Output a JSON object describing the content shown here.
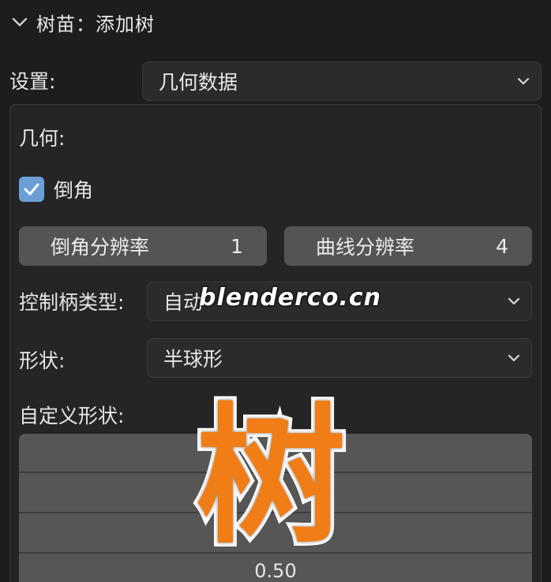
{
  "header": {
    "title": "树苗：添加树",
    "chevron_icon": "chevron-down-icon"
  },
  "settings": {
    "label": "设置:",
    "selected": "几何数据"
  },
  "geometry": {
    "section_title": "几何:",
    "bevel_checkbox": {
      "label": "倒角",
      "checked": true
    },
    "bevel_resolution": {
      "label": "倒角分辨率",
      "value": "1"
    },
    "curve_resolution": {
      "label": "曲线分辨率",
      "value": "4"
    },
    "handle_type": {
      "label": "控制柄类型:",
      "selected": "自动"
    },
    "shape": {
      "label": "形状:",
      "selected": "半球形"
    },
    "custom_shape": {
      "label": "自定义形状:",
      "visible_tick": "0.50"
    }
  },
  "watermark": {
    "site": "blenderco.cn",
    "char": "树"
  },
  "colors": {
    "background": "#1d1d1d",
    "panel": "#252525",
    "field": "#545454",
    "checkbox_accent": "#6c9fd6",
    "watermark_orange": "#f07d15"
  }
}
